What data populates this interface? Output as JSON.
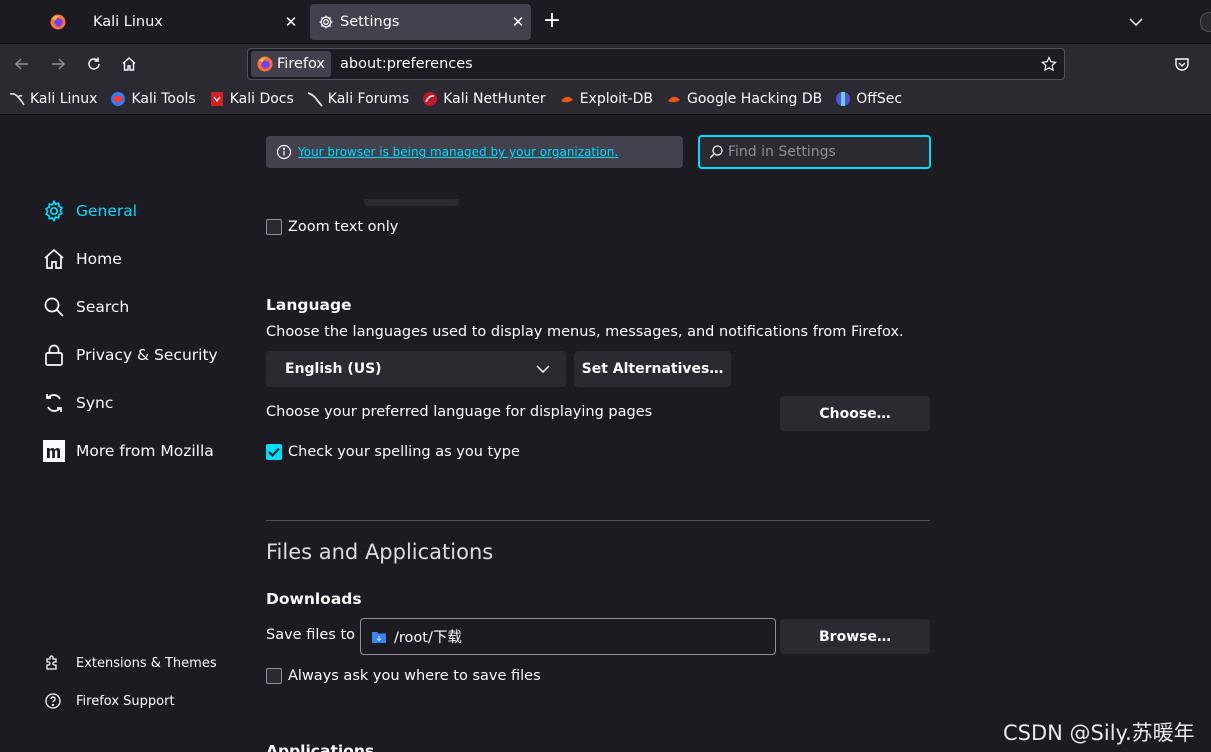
{
  "tabs": {
    "inactive_label": "Kali Linux",
    "active_label": "Settings",
    "close_glyph": "✕",
    "new_tab_glyph": "+"
  },
  "navbar": {
    "identity_label": "Firefox",
    "url": "about:preferences"
  },
  "bookmarks": [
    {
      "label": "Kali Linux",
      "icon": "kali-dragon-icon"
    },
    {
      "label": "Kali Tools",
      "icon": "kali-tools-icon"
    },
    {
      "label": "Kali Docs",
      "icon": "kali-docs-icon"
    },
    {
      "label": "Kali Forums",
      "icon": "kali-forums-icon"
    },
    {
      "label": "Kali NetHunter",
      "icon": "nethunter-icon"
    },
    {
      "label": "Exploit-DB",
      "icon": "exploit-db-icon"
    },
    {
      "label": "Google Hacking DB",
      "icon": "ghdb-icon"
    },
    {
      "label": "OffSec",
      "icon": "offsec-icon"
    }
  ],
  "sidebar": {
    "categories": [
      {
        "label": "General",
        "icon": "gear-icon",
        "selected": true
      },
      {
        "label": "Home",
        "icon": "home-icon"
      },
      {
        "label": "Search",
        "icon": "search-icon"
      },
      {
        "label": "Privacy & Security",
        "icon": "lock-icon"
      },
      {
        "label": "Sync",
        "icon": "sync-icon"
      },
      {
        "label": "More from Mozilla",
        "icon": "mozilla-icon"
      }
    ],
    "footer": {
      "extensions": "Extensions & Themes",
      "support": "Firefox Support"
    }
  },
  "main": {
    "policies_link": "Your browser is being managed by your organization.",
    "search_placeholder": "Find in Settings",
    "zoom_text_only": "Zoom text only",
    "language": {
      "heading": "Language",
      "description": "Choose the languages used to display menus, messages, and notifications from Firefox.",
      "selected": "English (US)",
      "set_alternatives": "Set Alternatives…",
      "pages_label": "Choose your preferred language for displaying pages",
      "choose_button": "Choose…",
      "spellcheck": "Check your spelling as you type",
      "spellcheck_checked": true
    },
    "files": {
      "section_title": "Files and Applications",
      "downloads_heading": "Downloads",
      "save_label": "Save files to",
      "save_path": "/root/下载",
      "browse_button": "Browse…",
      "always_ask": "Always ask you where to save files",
      "applications_heading": "Applications"
    }
  },
  "watermark": "CSDN @Sily.苏暖年",
  "colors": {
    "accent": "#00ddff",
    "background": "#1c1b22",
    "toolbar": "#2b2a33",
    "button": "#2b2a33"
  }
}
